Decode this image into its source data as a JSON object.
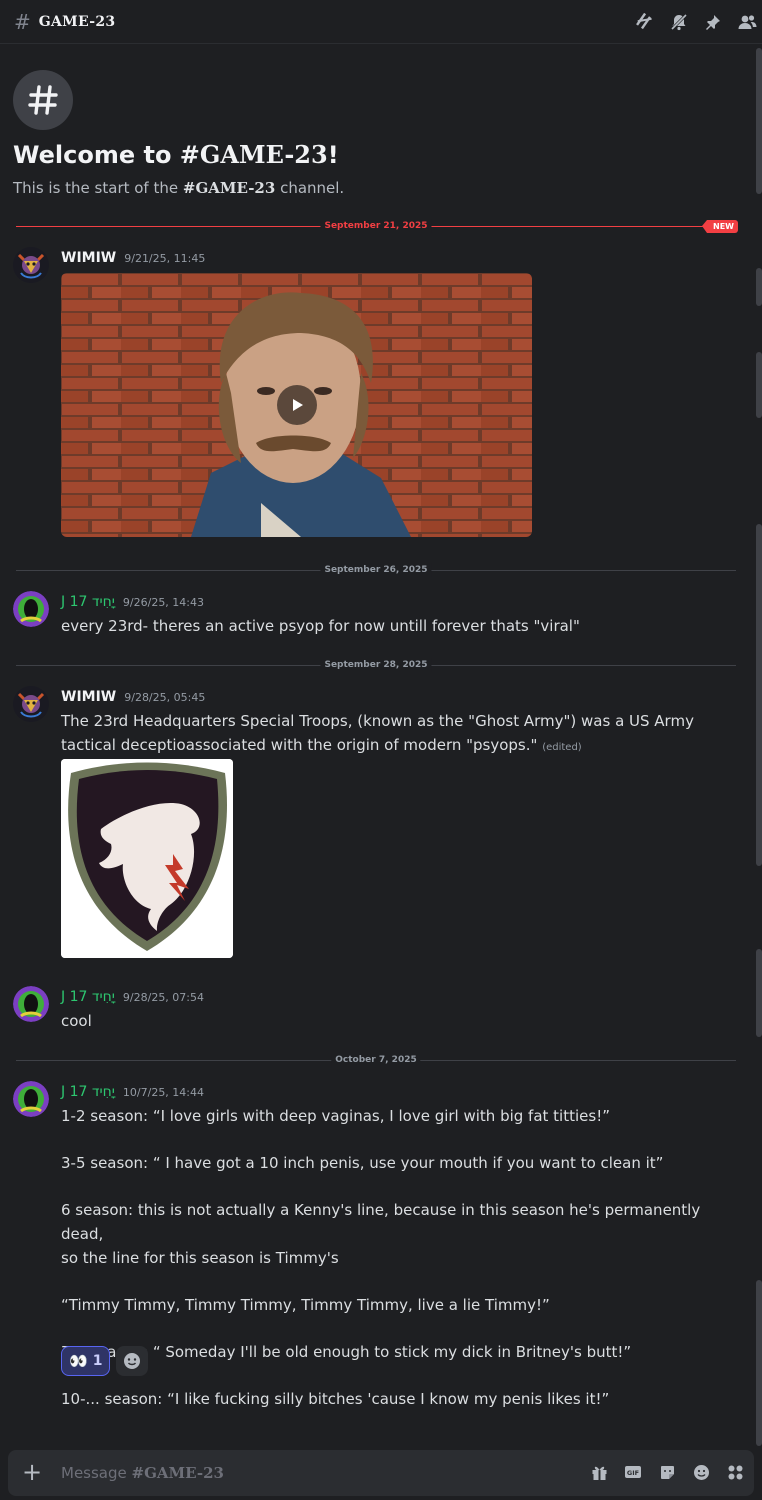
{
  "header": {
    "hash": "#",
    "channel_name": "GAME-23",
    "icons": [
      "threads-icon",
      "notifications-muted-icon",
      "pin-icon",
      "members-icon"
    ]
  },
  "welcome": {
    "hash": "#",
    "title_prefix": "Welcome to ",
    "title_channel": "#GAME-23",
    "title_suffix": "!",
    "sub_prefix": "This is the start of the ",
    "sub_channel": "#GAME-23",
    "sub_suffix": " channel."
  },
  "dividers": {
    "d1": "September 21, 2025",
    "new_label": "NEW",
    "d2": "September 26, 2025",
    "d3": "September 28, 2025",
    "d4": "October 7, 2025"
  },
  "messages": [
    {
      "author": "WIMIW",
      "timestamp": "9/21/25, 11:45"
    },
    {
      "author": "J 17 יָחִיד",
      "timestamp": "9/26/25, 14:43",
      "text": "every 23rd- theres an active psyop for now untill forever thats \"viral\""
    },
    {
      "author": "WIMIW",
      "timestamp": "9/28/25, 05:45",
      "text_line1": "The 23rd Headquarters Special Troops,  (known as the \"Ghost Army\") was a US Army",
      "text_line2": "tactical deceptioassociated with the origin of modern \"psyops.\"",
      "edited": "(edited)"
    },
    {
      "author": "J 17 יָחִיד",
      "timestamp": "9/28/25, 07:54",
      "text": "cool"
    },
    {
      "author": "J 17 יָחִיד",
      "timestamp": "10/7/25, 14:44",
      "lines": [
        "1-2 season: “I love girls with deep vaginas, I love girl with big fat titties!”",
        "3-5 season: “ I have got a 10 inch penis, use your mouth if you want to clean it”",
        "6 season: this is not actually a Kenny's line, because in this season he's permanently dead,",
        "so the line for this season is Timmy's",
        "“Timmy Timmy, Timmy Timmy, Timmy Timmy, live a lie Timmy!”",
        "7-9 season: “ Someday I'll be old enough to stick my dick in Britney's butt!”",
        "10-... season: “I like fucking silly bitches 'cause I know my penis likes it!”"
      ],
      "reaction": {
        "emoji": "👀",
        "count": "1"
      }
    }
  ],
  "composer": {
    "placeholder_prefix": "Message ",
    "placeholder_channel": "#GAME-23",
    "icons": [
      "gift-icon",
      "gif-icon",
      "sticker-icon",
      "emoji-icon",
      "apps-icon"
    ]
  }
}
